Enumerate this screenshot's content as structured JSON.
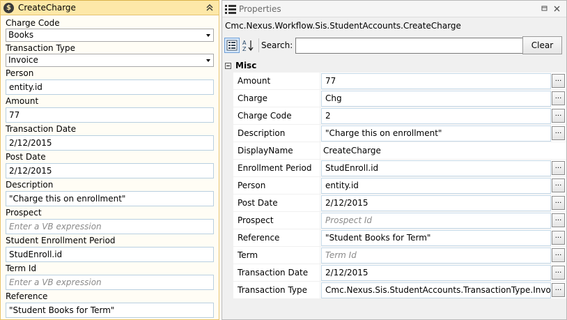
{
  "activity": {
    "badge": "$",
    "title": "CreateCharge",
    "fields": [
      {
        "label": "Charge Code",
        "kind": "combo",
        "value": "Books"
      },
      {
        "label": "Transaction Type",
        "kind": "combo",
        "value": "Invoice"
      },
      {
        "label": "Person",
        "kind": "text",
        "value": "entity.id"
      },
      {
        "label": "Amount",
        "kind": "text",
        "value": "77"
      },
      {
        "label": "Transaction Date",
        "kind": "text",
        "value": "2/12/2015"
      },
      {
        "label": "Post Date",
        "kind": "text",
        "value": "2/12/2015"
      },
      {
        "label": "Description",
        "kind": "text",
        "value": "\"Charge this on enrollment\""
      },
      {
        "label": "Prospect",
        "kind": "text",
        "value": "",
        "placeholder": "Enter a VB expression"
      },
      {
        "label": "Student Enrollment Period",
        "kind": "text",
        "value": "StudEnroll.id"
      },
      {
        "label": "Term Id",
        "kind": "text",
        "value": "",
        "placeholder": "Enter a VB expression"
      },
      {
        "label": "Reference",
        "kind": "text",
        "value": "\"Student Books for Term\""
      }
    ]
  },
  "properties": {
    "title": "Properties",
    "subtitle": "Cmc.Nexus.Workflow.Sis.StudentAccounts.CreateCharge",
    "search_label": "Search:",
    "search_value": "",
    "clear_label": "Clear",
    "category": "Misc",
    "rows": [
      {
        "name": "Amount",
        "value": "77",
        "placeholder": "",
        "editor": true
      },
      {
        "name": "Charge",
        "value": "Chg",
        "placeholder": "",
        "editor": true
      },
      {
        "name": "Charge Code",
        "value": "2",
        "placeholder": "",
        "editor": true
      },
      {
        "name": "Description",
        "value": "\"Charge this on enrollment\"",
        "placeholder": "",
        "editor": true
      },
      {
        "name": "DisplayName",
        "value": "CreateCharge",
        "placeholder": "",
        "editor": false
      },
      {
        "name": "Enrollment Period",
        "value": "StudEnroll.id",
        "placeholder": "",
        "editor": true
      },
      {
        "name": "Person",
        "value": "entity.id",
        "placeholder": "",
        "editor": true
      },
      {
        "name": "Post Date",
        "value": "2/12/2015",
        "placeholder": "",
        "editor": true
      },
      {
        "name": "Prospect",
        "value": "",
        "placeholder": "Prospect Id",
        "editor": true
      },
      {
        "name": "Reference",
        "value": "\"Student Books for Term\"",
        "placeholder": "",
        "editor": true
      },
      {
        "name": "Term",
        "value": "",
        "placeholder": "Term Id",
        "editor": true
      },
      {
        "name": "Transaction Date",
        "value": "2/12/2015",
        "placeholder": "",
        "editor": true
      },
      {
        "name": "Transaction Type",
        "value": "Cmc.Nexus.Sis.StudentAccounts.TransactionType.Invoice",
        "placeholder": "",
        "editor": true
      }
    ],
    "ellipsis_label": "..."
  },
  "colors": {
    "activity_header": "#fde8a8",
    "activity_border": "#e9c46a",
    "field_border": "#b8cfe0"
  }
}
